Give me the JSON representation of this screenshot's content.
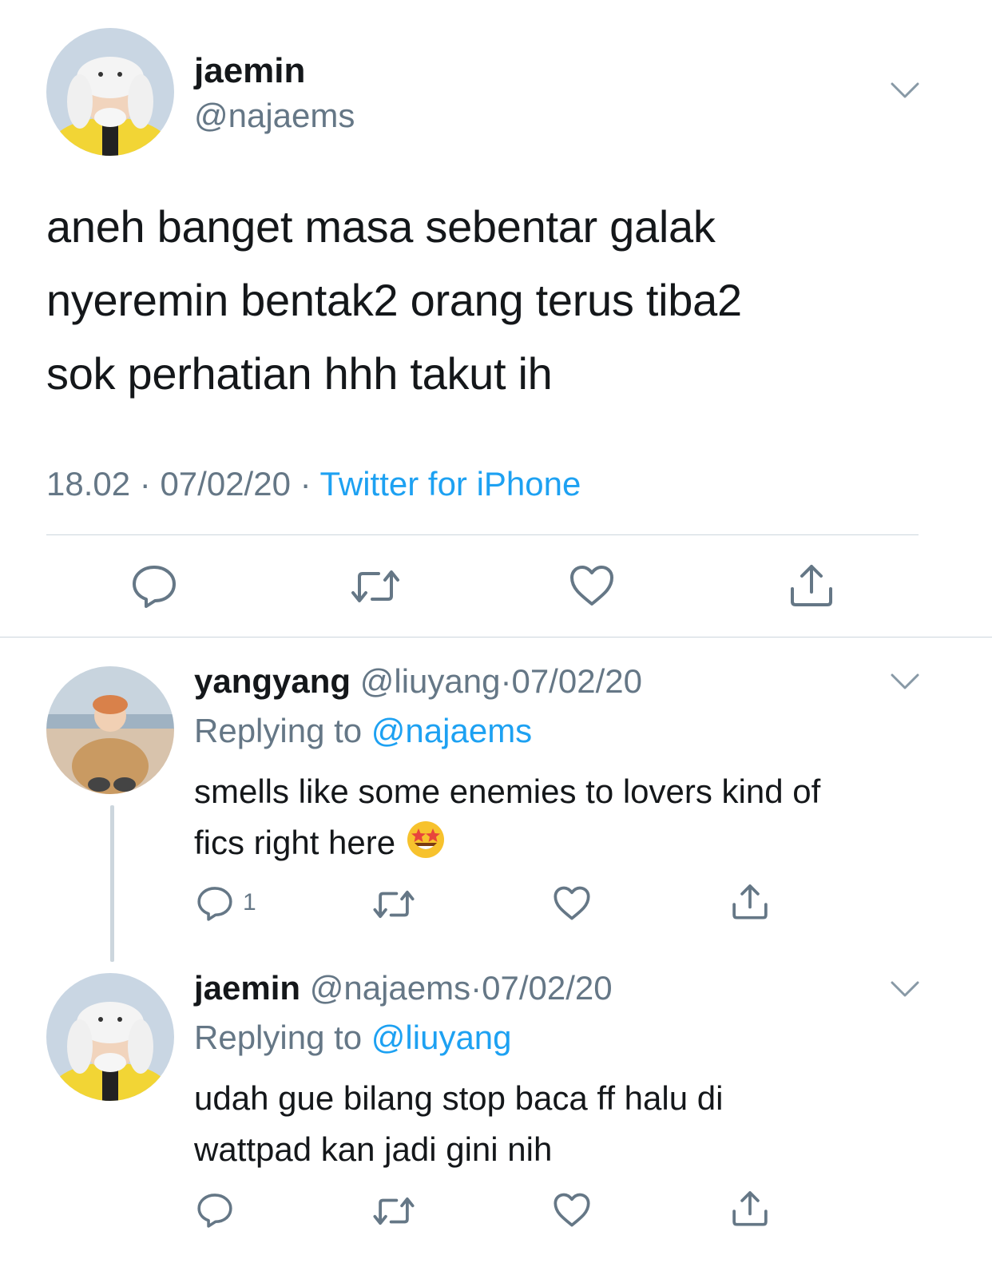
{
  "main_tweet": {
    "name": "jaemin",
    "handle": "@najaems",
    "text_lines": [
      "aneh banget masa sebentar galak",
      "nyeremin bentak2 orang terus tiba2",
      "sok perhatian hhh takut ih"
    ],
    "time": "18.02",
    "sep1": "·",
    "date": "07/02/20",
    "sep2": "·",
    "source": "Twitter for iPhone"
  },
  "reply1": {
    "name": "yangyang",
    "handle": "@liuyang",
    "sep": "·",
    "date": "07/02/20",
    "replying_prefix": "Replying to",
    "replying_to": "@najaems",
    "text_line1": "smells like some enemies to lovers kind of",
    "text_line2": "fics right here",
    "emoji": "star-struck",
    "reply_count": "1"
  },
  "reply2": {
    "name": "jaemin",
    "handle": "@najaems",
    "sep": "·",
    "date": "07/02/20",
    "replying_prefix": "Replying to",
    "replying_to": "@liuyang",
    "text_line1": "udah gue bilang stop baca ff halu di",
    "text_line2": "wattpad kan jadi gini nih"
  },
  "colors": {
    "accent": "#1da1f2",
    "secondary": "#657786",
    "icon": "#657786",
    "divider": "#ccd6dd"
  }
}
